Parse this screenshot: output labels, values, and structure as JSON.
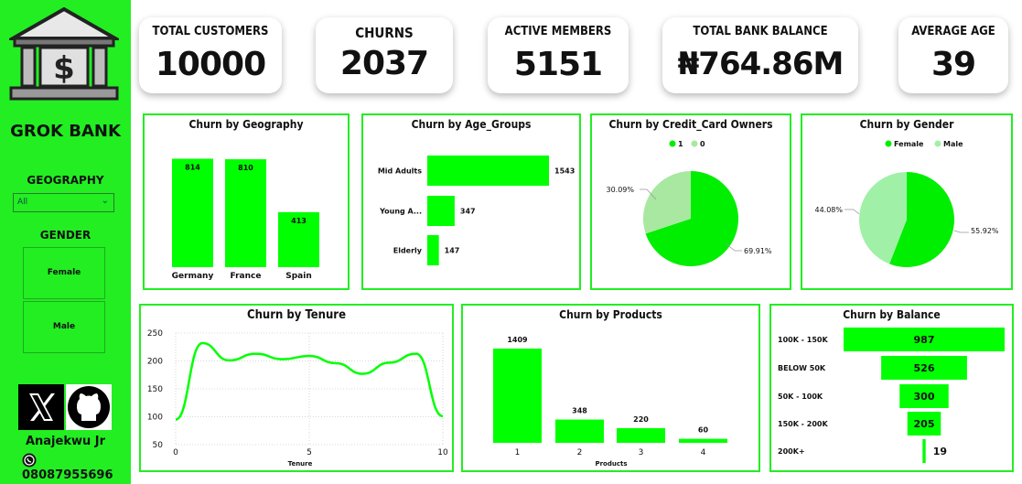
{
  "sidebar": {
    "brand": "GROK BANK",
    "geography_label": "GEOGRAPHY",
    "geography_selected": "All",
    "gender_label": "GENDER",
    "gender_options": [
      "Female",
      "Male"
    ],
    "author": "Anajekwu Jr",
    "phone": "08087955696",
    "icons": [
      "bank-icon",
      "x-logo-icon",
      "github-icon",
      "whatsapp-icon"
    ],
    "bg_color": "#22ee22"
  },
  "kpis": {
    "total_customers": {
      "label": "TOTAL CUSTOMERS",
      "value": "10000"
    },
    "churns": {
      "label": "CHURNS",
      "value": "2037"
    },
    "active_members": {
      "label": "ACTIVE MEMBERS",
      "value": "5151"
    },
    "total_bank_balance": {
      "label": "TOTAL BANK BALANCE",
      "value": "₦764.86M"
    },
    "average_age": {
      "label": "AVERAGE AGE",
      "value": "39"
    }
  },
  "accent_color": "#00ff00",
  "chart_data": [
    {
      "id": "geography",
      "type": "bar",
      "title": "Churn by Geography",
      "categories": [
        "Germany",
        "France",
        "Spain"
      ],
      "values": [
        814,
        810,
        413
      ],
      "ylim": [
        0,
        900
      ]
    },
    {
      "id": "age_groups",
      "type": "bar",
      "orientation": "horizontal",
      "title": "Churn by Age_Groups",
      "categories": [
        "Mid Adults",
        "Young A...",
        "Elderly"
      ],
      "values": [
        1543,
        347,
        147
      ]
    },
    {
      "id": "credit_card",
      "type": "pie",
      "donut": false,
      "title": "Churn by Credit_Card Owners",
      "legend": [
        "1",
        "0"
      ],
      "values": [
        69.91,
        30.09
      ],
      "labels": [
        "69.91%",
        "30.09%"
      ],
      "colors": [
        "#00ee00",
        "#a8e8a0"
      ]
    },
    {
      "id": "gender",
      "type": "pie",
      "title": "Churn by Gender",
      "legend": [
        "Female",
        "Male"
      ],
      "values": [
        55.92,
        44.08
      ],
      "labels": [
        "55.92%",
        "44.08%"
      ],
      "colors": [
        "#00ee00",
        "#a0f0a8"
      ]
    },
    {
      "id": "tenure",
      "type": "line",
      "title": "Churn by Tenure",
      "xlabel": "Tenure",
      "x": [
        0,
        1,
        2,
        3,
        4,
        5,
        6,
        7,
        8,
        9,
        10
      ],
      "values": [
        95,
        232,
        201,
        213,
        203,
        209,
        196,
        177,
        197,
        213,
        101
      ],
      "ylim": [
        50,
        250
      ],
      "yticks": [
        50,
        100,
        150,
        200,
        250
      ],
      "xticks": [
        0,
        5,
        10
      ],
      "grid": true
    },
    {
      "id": "products",
      "type": "bar",
      "title": "Churn by Products",
      "xlabel": "Products",
      "categories": [
        "1",
        "2",
        "3",
        "4"
      ],
      "values": [
        1409,
        348,
        220,
        60
      ],
      "ylim": [
        0,
        1500
      ]
    },
    {
      "id": "balance",
      "type": "bar",
      "orientation": "funnel",
      "title": "Churn by Balance",
      "categories": [
        "100K - 150K",
        "BELOW 50K",
        "50K - 100K",
        "150K - 200K",
        "200K+"
      ],
      "values": [
        987,
        526,
        300,
        205,
        19
      ]
    }
  ]
}
